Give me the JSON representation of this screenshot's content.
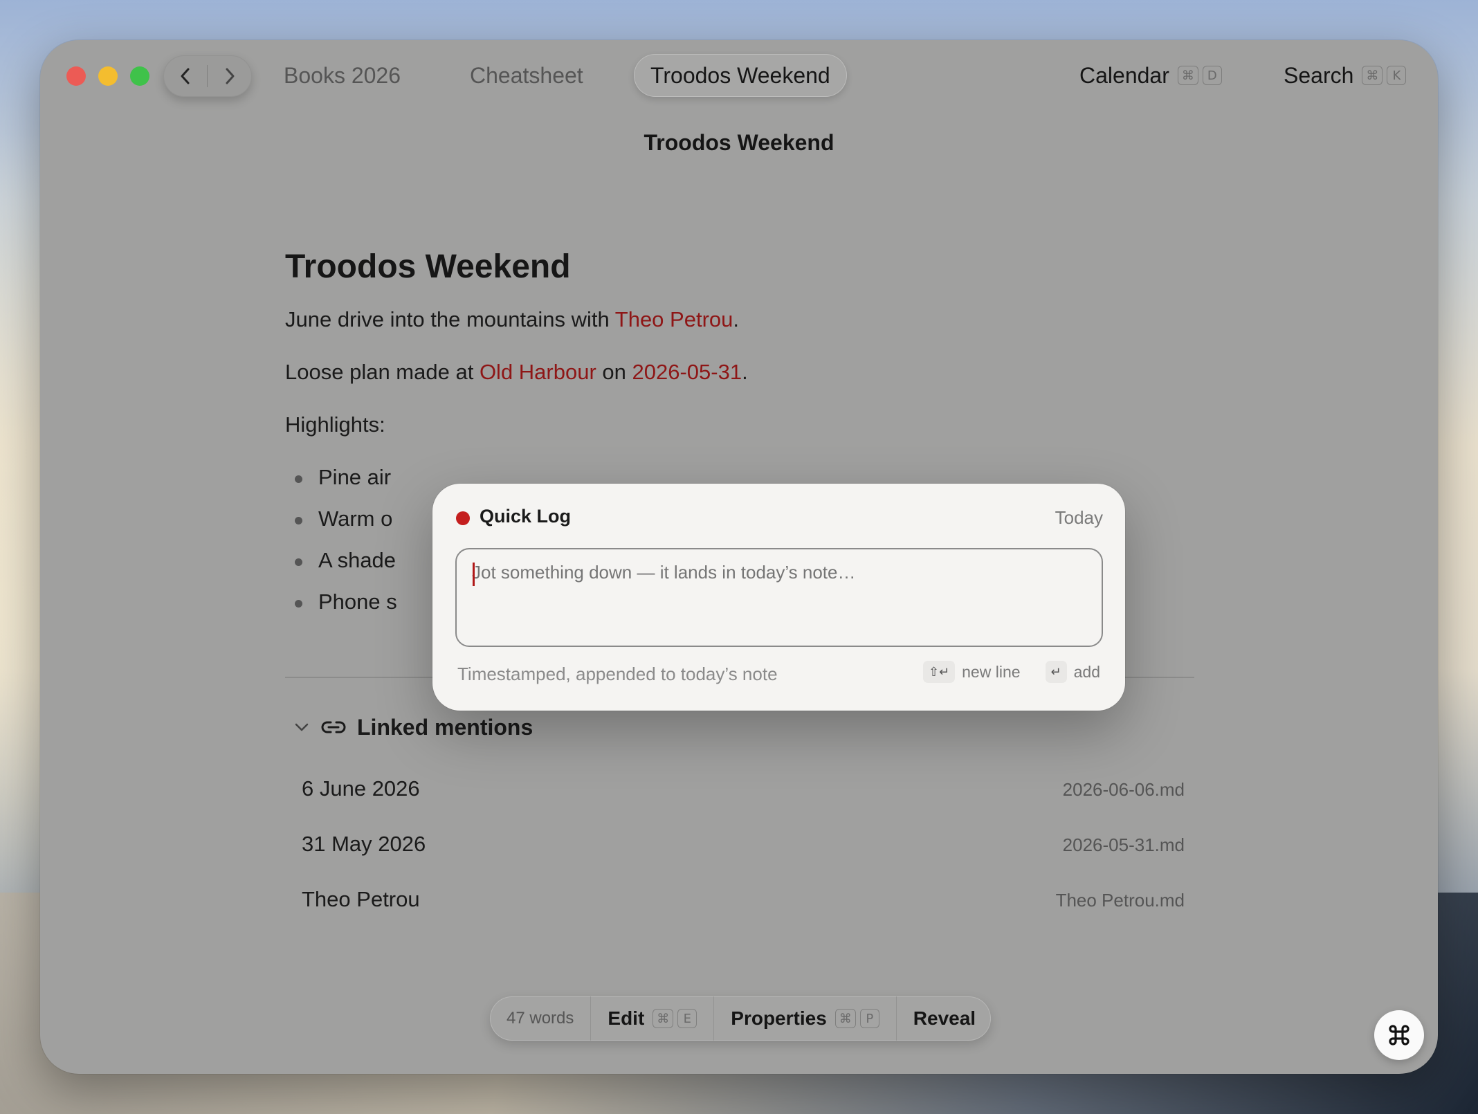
{
  "window": {
    "tabs": [
      {
        "label": "Books 2026",
        "active": false
      },
      {
        "label": "Cheatsheet",
        "active": false
      },
      {
        "label": "Troodos Weekend",
        "active": true
      }
    ],
    "calendar": {
      "label": "Calendar",
      "keys": [
        "⌘",
        "D"
      ]
    },
    "search": {
      "label": "Search",
      "keys": [
        "⌘",
        "K"
      ]
    },
    "title": "Troodos Weekend"
  },
  "note": {
    "heading": "Troodos Weekend",
    "line1": {
      "before": "June drive into the mountains with ",
      "link": "Theo Petrou",
      "after": "."
    },
    "line2": {
      "before": "Loose plan made at ",
      "link1": "Old Harbour",
      "middle": " on ",
      "link2": "2026-05-31",
      "after": "."
    },
    "highlights_label": "Highlights:",
    "bullets": [
      "Pine air",
      "Warm o",
      "A shade",
      "Phone s"
    ]
  },
  "linked_mentions": {
    "title": "Linked mentions",
    "items": [
      {
        "name": "6 June 2026",
        "file": "2026-06-06.md"
      },
      {
        "name": "31 May 2026",
        "file": "2026-05-31.md"
      },
      {
        "name": "Theo Petrou",
        "file": "Theo Petrou.md"
      }
    ]
  },
  "bottom_bar": {
    "word_count": "47 words",
    "edit": {
      "label": "Edit",
      "keys": [
        "⌘",
        "E"
      ]
    },
    "properties": {
      "label": "Properties",
      "keys": [
        "⌘",
        "P"
      ]
    },
    "reveal": {
      "label": "Reveal"
    }
  },
  "quick_log": {
    "title": "Quick Log",
    "date_label": "Today",
    "placeholder": "Jot something down — it lands in today’s note…",
    "footer": "Timestamped, appended to today’s note",
    "hint_newline": {
      "key": "⇧↵",
      "label": "new line"
    },
    "hint_add": {
      "key": "↵",
      "label": "add"
    },
    "accent_color": "#c41e1e"
  },
  "colors": {
    "link": "#8e1616"
  }
}
